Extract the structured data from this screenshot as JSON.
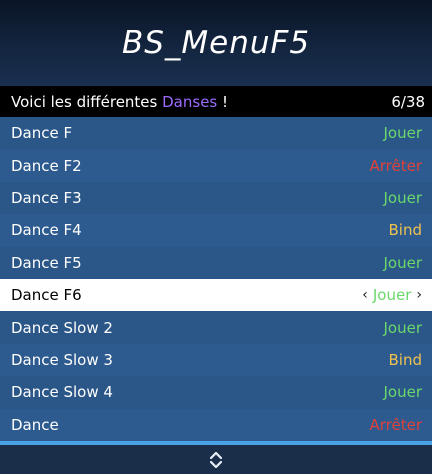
{
  "menu": {
    "title": "BS_MenuF5",
    "subtitle_prefix": "Voici les différentes ",
    "subtitle_accent": "Danses",
    "subtitle_suffix": " !",
    "counter": "6/38"
  },
  "items": [
    {
      "label": "Dance F",
      "action": "Jouer",
      "color": "#6bd86b"
    },
    {
      "label": "Dance F2",
      "action": "Arrêter",
      "color": "#e0413a"
    },
    {
      "label": "Dance F3",
      "action": "Jouer",
      "color": "#6bd86b"
    },
    {
      "label": "Dance F4",
      "action": "Bind",
      "color": "#f0c24d"
    },
    {
      "label": "Dance F5",
      "action": "Jouer",
      "color": "#6bd86b"
    },
    {
      "label": "Dance F6",
      "action": "Jouer",
      "color": "#6bd86b",
      "selected": true
    },
    {
      "label": "Dance Slow 2",
      "action": "Jouer",
      "color": "#6bd86b"
    },
    {
      "label": "Dance Slow 3",
      "action": "Bind",
      "color": "#f0c24d"
    },
    {
      "label": "Dance Slow 4",
      "action": "Jouer",
      "color": "#6bd86b"
    },
    {
      "label": "Dance",
      "action": "Arrêter",
      "color": "#e0413a"
    }
  ],
  "icons": {
    "arrow_left": "‹",
    "arrow_right": "›",
    "scroll": "up-down-chevron-icon"
  }
}
